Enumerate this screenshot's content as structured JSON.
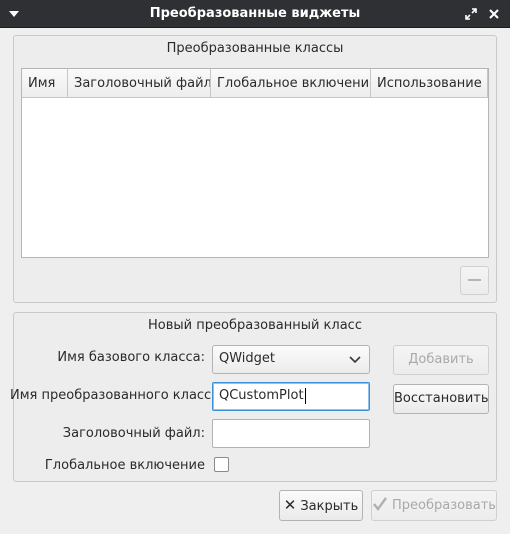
{
  "window": {
    "title": "Преобразованные виджеты"
  },
  "promoted_classes": {
    "title": "Преобразованные классы",
    "columns": [
      "Имя",
      "Заголовочный файл",
      "Глобальное включение",
      "Использование"
    ],
    "rows": []
  },
  "new_class": {
    "title": "Новый преобразованный класс",
    "base_class_label": "Имя базового класса:",
    "base_class_value": "QWidget",
    "promoted_class_label": "Имя преобразованного класса:",
    "promoted_class_value": "QCustomPlot",
    "header_file_label": "Заголовочный файл:",
    "header_file_value": "",
    "global_include_label": "Глобальное включение",
    "global_include_checked": false,
    "add_label": "Добавить",
    "reset_label": "Восстановить"
  },
  "footer": {
    "close_label": "Закрыть",
    "promote_label": "Преобразовать"
  },
  "colors": {
    "titlebar": "#2f3033",
    "focus": "#3d8fd8",
    "disabled_text": "#a9a9a9"
  }
}
